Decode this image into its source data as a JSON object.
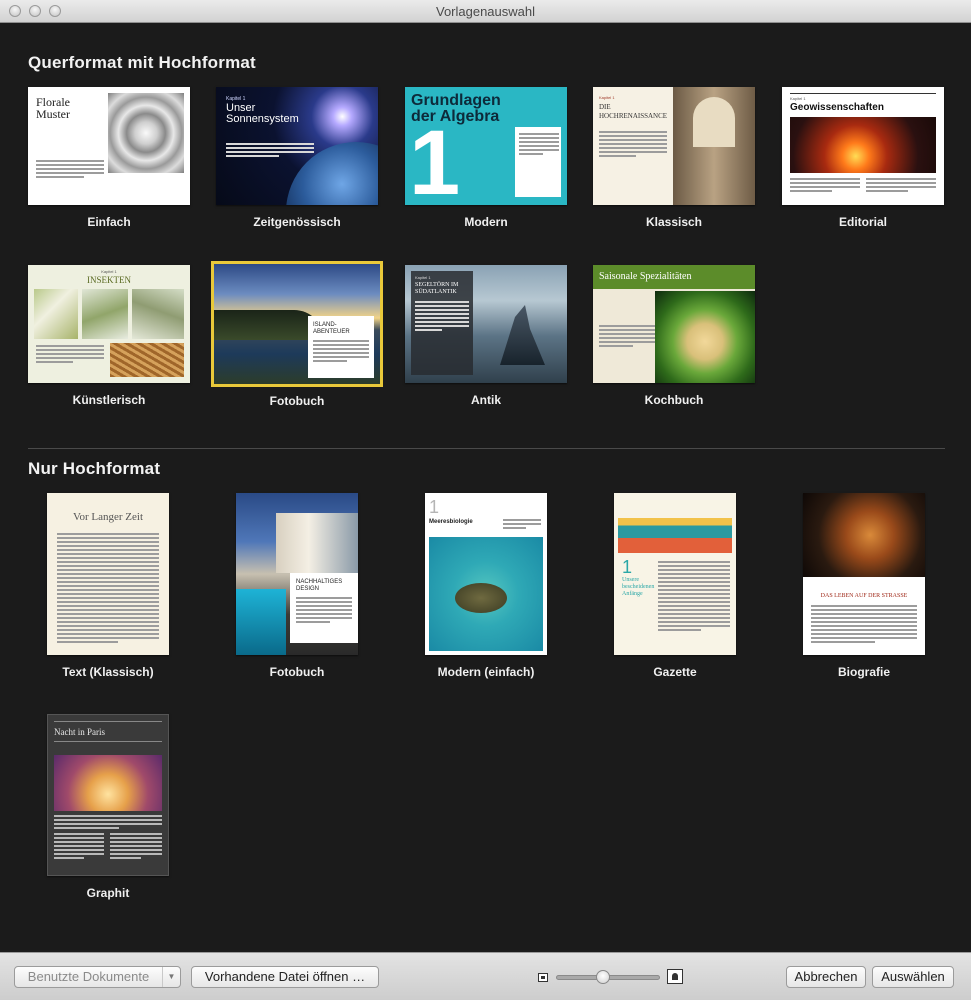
{
  "window": {
    "title": "Vorlagenauswahl"
  },
  "sections": [
    {
      "title": "Querformat mit Hochformat"
    },
    {
      "title": "Nur Hochformat"
    }
  ],
  "landscape_templates": [
    {
      "label": "Einfach",
      "thumb_title": "Florale Muster",
      "selected": false
    },
    {
      "label": "Zeitgenössisch",
      "thumb_kicker": "Kapitel 1",
      "thumb_title": "Unser Sonnensystem",
      "selected": false
    },
    {
      "label": "Modern",
      "thumb_title": "Grundlagen der Algebra",
      "thumb_number": "1",
      "selected": false
    },
    {
      "label": "Klassisch",
      "thumb_kicker": "Kapitel 1",
      "thumb_title": "Die Hochrenaissance",
      "selected": false
    },
    {
      "label": "Editorial",
      "thumb_kicker": "Kapitel 1",
      "thumb_title": "Geowissenschaften",
      "selected": false
    },
    {
      "label": "Künstlerisch",
      "thumb_kicker": "Kapitel 1",
      "thumb_title": "Insekten",
      "selected": false
    },
    {
      "label": "Fotobuch",
      "thumb_title": "Island-Abenteuer",
      "selected": true
    },
    {
      "label": "Antik",
      "thumb_kicker": "Kapitel 1",
      "thumb_title": "Segeltörn im Südatlantik",
      "selected": false
    },
    {
      "label": "Kochbuch",
      "thumb_title": "Saisonale Spezialitäten",
      "selected": false
    }
  ],
  "portrait_templates": [
    {
      "label": "Text (Klassisch)",
      "thumb_title": "Vor Langer Zeit"
    },
    {
      "label": "Fotobuch",
      "thumb_title": "Nachhaltiges Design"
    },
    {
      "label": "Modern (einfach)",
      "thumb_title": "Meeresbiologie",
      "thumb_number": "1"
    },
    {
      "label": "Gazette",
      "thumb_number": "1",
      "thumb_title": "Unsere bescheidenen Anfänge"
    },
    {
      "label": "Biografie",
      "thumb_title": "Das Leben auf der Straße"
    },
    {
      "label": "Graphit",
      "thumb_title": "Nacht in Paris"
    }
  ],
  "bottom_bar": {
    "recent_button": "Benutzte Dokumente",
    "open_button": "Vorhandene Datei öffnen …",
    "cancel_button": "Abbrechen",
    "choose_button": "Auswählen",
    "zoom_level": 0.45
  },
  "icons": {
    "zoom_small": "small-thumbnail-icon",
    "zoom_large": "large-thumbnail-icon",
    "dropdown": "chevron-down-icon"
  },
  "colors": {
    "background": "#1b1b1b",
    "selection": "#e9c93a",
    "modern_accent": "#2ab7c4",
    "kochbuch_green": "#5c8c2a"
  }
}
